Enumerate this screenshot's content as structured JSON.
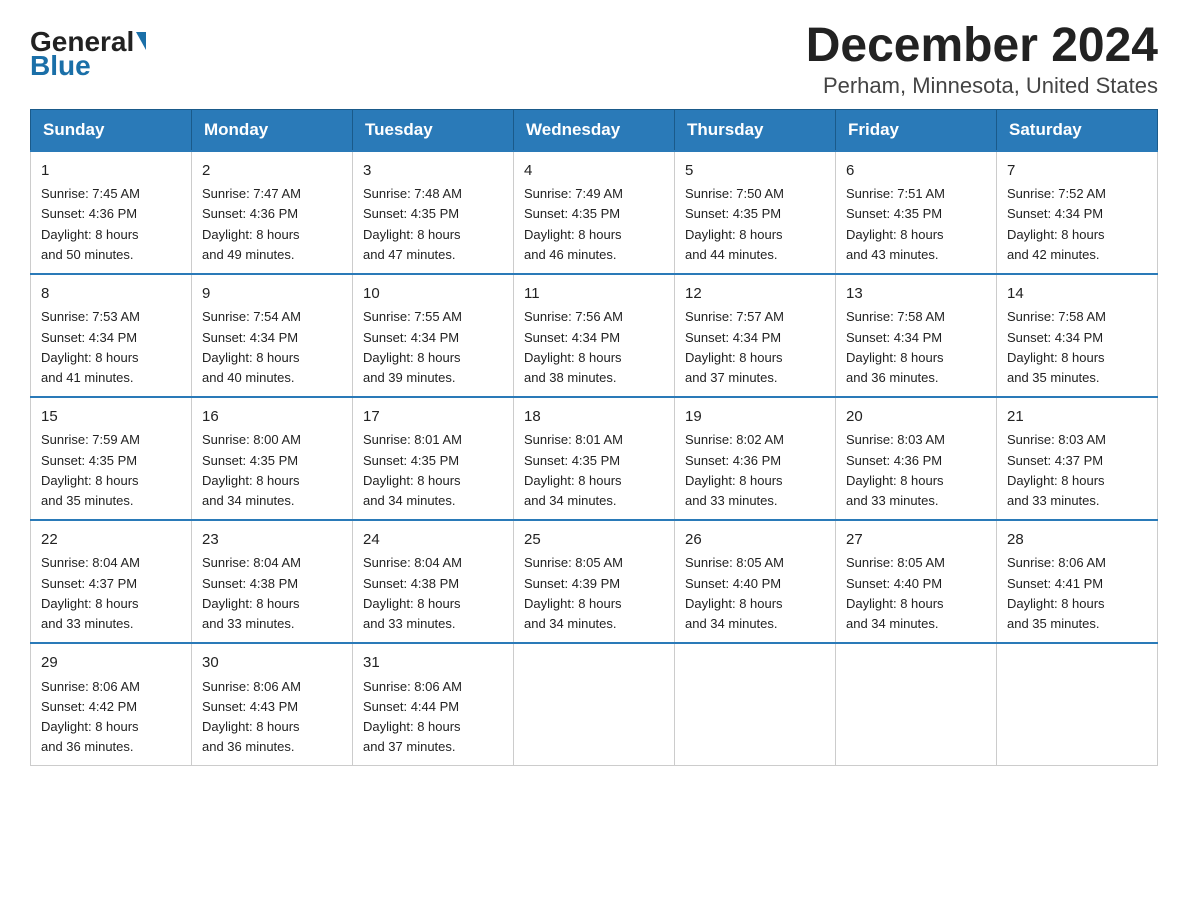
{
  "logo": {
    "general": "General",
    "blue": "Blue"
  },
  "title": "December 2024",
  "subtitle": "Perham, Minnesota, United States",
  "days_of_week": [
    "Sunday",
    "Monday",
    "Tuesday",
    "Wednesday",
    "Thursday",
    "Friday",
    "Saturday"
  ],
  "weeks": [
    [
      {
        "day": "1",
        "sunrise": "7:45 AM",
        "sunset": "4:36 PM",
        "daylight": "8 hours and 50 minutes."
      },
      {
        "day": "2",
        "sunrise": "7:47 AM",
        "sunset": "4:36 PM",
        "daylight": "8 hours and 49 minutes."
      },
      {
        "day": "3",
        "sunrise": "7:48 AM",
        "sunset": "4:35 PM",
        "daylight": "8 hours and 47 minutes."
      },
      {
        "day": "4",
        "sunrise": "7:49 AM",
        "sunset": "4:35 PM",
        "daylight": "8 hours and 46 minutes."
      },
      {
        "day": "5",
        "sunrise": "7:50 AM",
        "sunset": "4:35 PM",
        "daylight": "8 hours and 44 minutes."
      },
      {
        "day": "6",
        "sunrise": "7:51 AM",
        "sunset": "4:35 PM",
        "daylight": "8 hours and 43 minutes."
      },
      {
        "day": "7",
        "sunrise": "7:52 AM",
        "sunset": "4:34 PM",
        "daylight": "8 hours and 42 minutes."
      }
    ],
    [
      {
        "day": "8",
        "sunrise": "7:53 AM",
        "sunset": "4:34 PM",
        "daylight": "8 hours and 41 minutes."
      },
      {
        "day": "9",
        "sunrise": "7:54 AM",
        "sunset": "4:34 PM",
        "daylight": "8 hours and 40 minutes."
      },
      {
        "day": "10",
        "sunrise": "7:55 AM",
        "sunset": "4:34 PM",
        "daylight": "8 hours and 39 minutes."
      },
      {
        "day": "11",
        "sunrise": "7:56 AM",
        "sunset": "4:34 PM",
        "daylight": "8 hours and 38 minutes."
      },
      {
        "day": "12",
        "sunrise": "7:57 AM",
        "sunset": "4:34 PM",
        "daylight": "8 hours and 37 minutes."
      },
      {
        "day": "13",
        "sunrise": "7:58 AM",
        "sunset": "4:34 PM",
        "daylight": "8 hours and 36 minutes."
      },
      {
        "day": "14",
        "sunrise": "7:58 AM",
        "sunset": "4:34 PM",
        "daylight": "8 hours and 35 minutes."
      }
    ],
    [
      {
        "day": "15",
        "sunrise": "7:59 AM",
        "sunset": "4:35 PM",
        "daylight": "8 hours and 35 minutes."
      },
      {
        "day": "16",
        "sunrise": "8:00 AM",
        "sunset": "4:35 PM",
        "daylight": "8 hours and 34 minutes."
      },
      {
        "day": "17",
        "sunrise": "8:01 AM",
        "sunset": "4:35 PM",
        "daylight": "8 hours and 34 minutes."
      },
      {
        "day": "18",
        "sunrise": "8:01 AM",
        "sunset": "4:35 PM",
        "daylight": "8 hours and 34 minutes."
      },
      {
        "day": "19",
        "sunrise": "8:02 AM",
        "sunset": "4:36 PM",
        "daylight": "8 hours and 33 minutes."
      },
      {
        "day": "20",
        "sunrise": "8:03 AM",
        "sunset": "4:36 PM",
        "daylight": "8 hours and 33 minutes."
      },
      {
        "day": "21",
        "sunrise": "8:03 AM",
        "sunset": "4:37 PM",
        "daylight": "8 hours and 33 minutes."
      }
    ],
    [
      {
        "day": "22",
        "sunrise": "8:04 AM",
        "sunset": "4:37 PM",
        "daylight": "8 hours and 33 minutes."
      },
      {
        "day": "23",
        "sunrise": "8:04 AM",
        "sunset": "4:38 PM",
        "daylight": "8 hours and 33 minutes."
      },
      {
        "day": "24",
        "sunrise": "8:04 AM",
        "sunset": "4:38 PM",
        "daylight": "8 hours and 33 minutes."
      },
      {
        "day": "25",
        "sunrise": "8:05 AM",
        "sunset": "4:39 PM",
        "daylight": "8 hours and 34 minutes."
      },
      {
        "day": "26",
        "sunrise": "8:05 AM",
        "sunset": "4:40 PM",
        "daylight": "8 hours and 34 minutes."
      },
      {
        "day": "27",
        "sunrise": "8:05 AM",
        "sunset": "4:40 PM",
        "daylight": "8 hours and 34 minutes."
      },
      {
        "day": "28",
        "sunrise": "8:06 AM",
        "sunset": "4:41 PM",
        "daylight": "8 hours and 35 minutes."
      }
    ],
    [
      {
        "day": "29",
        "sunrise": "8:06 AM",
        "sunset": "4:42 PM",
        "daylight": "8 hours and 36 minutes."
      },
      {
        "day": "30",
        "sunrise": "8:06 AM",
        "sunset": "4:43 PM",
        "daylight": "8 hours and 36 minutes."
      },
      {
        "day": "31",
        "sunrise": "8:06 AM",
        "sunset": "4:44 PM",
        "daylight": "8 hours and 37 minutes."
      },
      null,
      null,
      null,
      null
    ]
  ],
  "labels": {
    "sunrise": "Sunrise:",
    "sunset": "Sunset:",
    "daylight": "Daylight:"
  }
}
